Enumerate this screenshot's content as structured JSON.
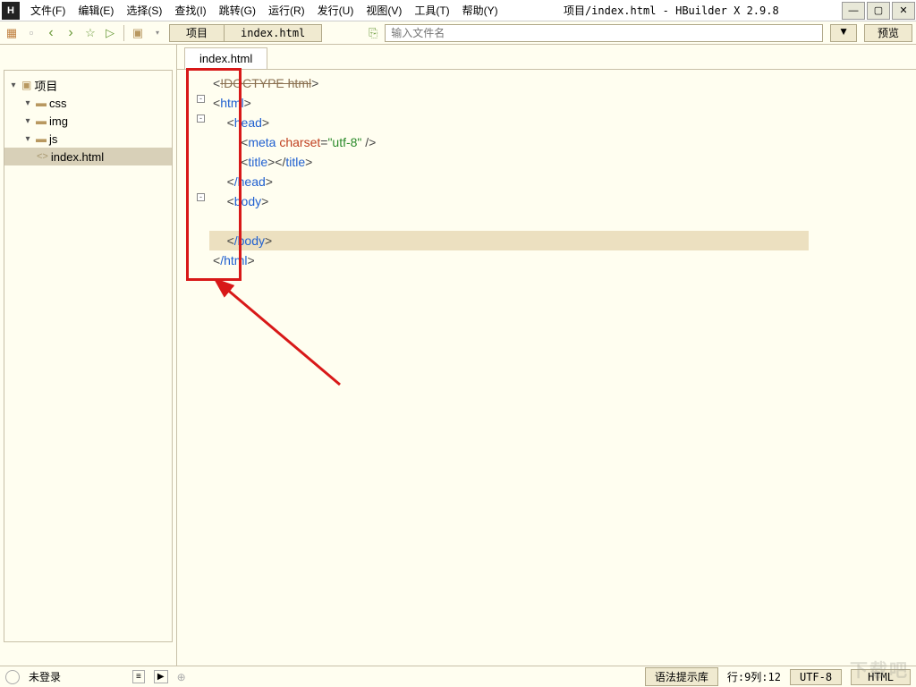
{
  "app": {
    "icon_letter": "H",
    "title": "项目/index.html - HBuilder X 2.9.8"
  },
  "menu": {
    "file": "文件(F)",
    "edit": "编辑(E)",
    "select": "选择(S)",
    "find": "查找(I)",
    "goto": "跳转(G)",
    "run": "运行(R)",
    "publish": "发行(U)",
    "view": "视图(V)",
    "tools": "工具(T)",
    "help": "帮助(Y)"
  },
  "win": {
    "min": "—",
    "max": "▢",
    "close": "✕"
  },
  "toolbar": {
    "back": "‹",
    "fwd": "›",
    "star": "☆",
    "run": "▷",
    "folder": "▣",
    "crumb_project": "项目",
    "crumb_file": "index.html",
    "refresh": "⟳",
    "filename_placeholder": "输入文件名",
    "filter": "▼",
    "preview": "预览"
  },
  "sidebar": {
    "root": "项目",
    "nodes": [
      {
        "label": "css",
        "type": "folder"
      },
      {
        "label": "img",
        "type": "folder"
      },
      {
        "label": "js",
        "type": "folder"
      },
      {
        "label": "index.html",
        "type": "file",
        "selected": true
      }
    ]
  },
  "editor": {
    "tab": "index.html",
    "lines": {
      "doctype": "<!DOCTYPE html>",
      "html_open": "html",
      "head_open": "head",
      "meta_tag": "meta",
      "meta_attr": "charset",
      "meta_val": "\"utf-8\"",
      "title_tag": "title",
      "head_close": "/head",
      "body_open": "body",
      "body_close": "/body",
      "html_close": "/html"
    }
  },
  "status": {
    "login": "未登录",
    "syntax": "语法提示库",
    "pos": "行:9列:12",
    "encoding": "UTF-8",
    "lang": "HTML"
  },
  "watermark": "下载吧"
}
